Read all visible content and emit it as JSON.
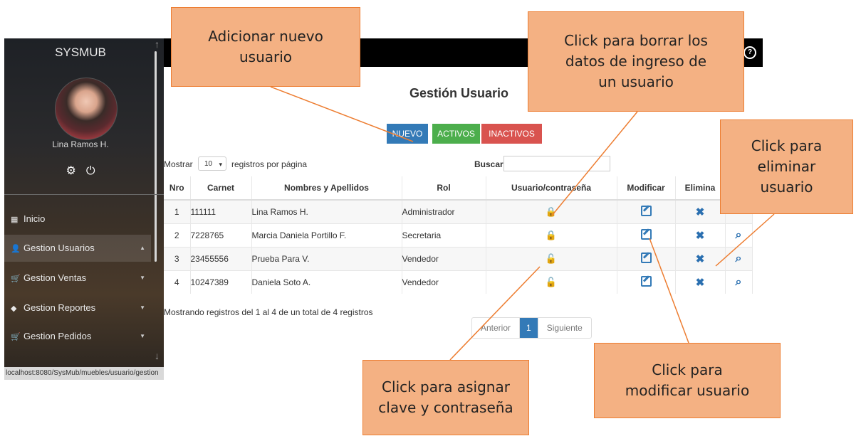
{
  "sidebar": {
    "app_title": "SYSMUB",
    "user_name": "Lina Ramos H.",
    "items": [
      {
        "label": "Inicio",
        "icon": "dashboard-icon"
      },
      {
        "label": "Gestion Usuarios",
        "icon": "user-icon"
      },
      {
        "label": "Gestion Ventas",
        "icon": "cart-icon"
      },
      {
        "label": "Gestion Reportes",
        "icon": "box-icon"
      },
      {
        "label": "Gestion Pedidos",
        "icon": "cart-icon"
      }
    ],
    "status_url": "localhost:8080/SysMub/muebles/usuario/gestion"
  },
  "main": {
    "title": "Gestión Usuario",
    "buttons": {
      "nuevo": "NUEVO",
      "activos": "ACTIVOS",
      "inactivos": "INACTIVOS"
    },
    "length": {
      "label": "Mostrar",
      "value": "10",
      "suffix": "registros por página"
    },
    "search_label": "Buscar:",
    "table": {
      "headers": [
        "Nro",
        "Carnet",
        "Nombres y Apellidos",
        "Rol",
        "Usuario/contraseña",
        "Modificar",
        "Elimina"
      ],
      "rows": [
        {
          "nro": "1",
          "carnet": "111111",
          "name": "Lina Ramos H.",
          "rol": "Administrador",
          "lock": "locked"
        },
        {
          "nro": "2",
          "carnet": "7228765",
          "name": "Marcia Daniela Portillo F.",
          "rol": "Secretaria",
          "lock": "locked"
        },
        {
          "nro": "3",
          "carnet": "23455556",
          "name": "Prueba Para V.",
          "rol": "Vendedor",
          "lock": "unlocked"
        },
        {
          "nro": "4",
          "carnet": "10247389",
          "name": "Daniela Soto A.",
          "rol": "Vendedor",
          "lock": "unlocked"
        }
      ]
    },
    "info": "Mostrando registros del 1 al 4 de un total de 4 registros",
    "pager": {
      "prev": "Anterior",
      "current": "1",
      "next": "Siguiente"
    }
  },
  "callouts": {
    "nuevo": [
      "Adicionar nuevo",
      "usuario"
    ],
    "borrar": [
      "Click para borrar los",
      "datos de ingreso de",
      "un usuario"
    ],
    "eliminar": [
      "Click para",
      "eliminar",
      "usuario"
    ],
    "asignar": [
      "Click para asignar",
      "clave y contraseña"
    ],
    "modificar": [
      "Click para",
      "modificar usuario"
    ]
  },
  "colors": {
    "primary": "#337ab7",
    "success": "#4cae4c",
    "danger": "#d9534f",
    "callout": "#f4b183",
    "callout_border": "#ed7d31"
  }
}
